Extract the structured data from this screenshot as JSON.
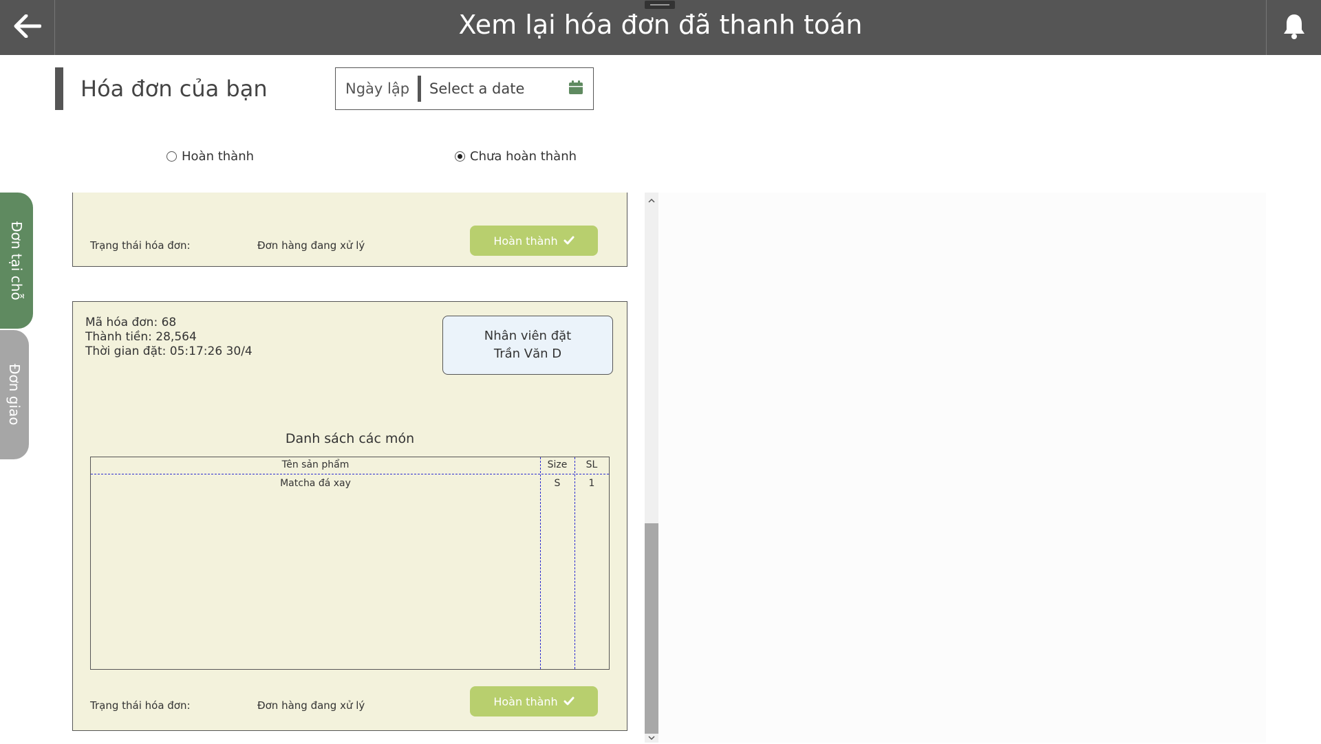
{
  "topbar": {
    "title": "Xem lại hóa đơn đã thanh toán",
    "back_icon": "arrow-left-icon",
    "bell_icon": "bell-icon"
  },
  "header": {
    "title": "Hóa đơn của bạn",
    "date_filter": {
      "label": "Ngày lập",
      "placeholder": "Select a date",
      "icon": "calendar-icon"
    }
  },
  "filters": {
    "options": [
      {
        "label": "Hoàn thành",
        "checked": false
      },
      {
        "label": "Chưa hoàn thành",
        "checked": true
      }
    ]
  },
  "side_tabs": [
    {
      "label": "Đơn tại chỗ",
      "active": true
    },
    {
      "label": "Đơn giao",
      "active": false
    }
  ],
  "table_headers": {
    "product": "Tên sản phẩm",
    "size": "Size",
    "qty": "SL"
  },
  "orders": [
    {
      "status_label": "Trạng thái hóa đơn:",
      "status_value": "Đơn hàng đang xử lý",
      "complete_button": "Hoàn thành"
    },
    {
      "id_line": "Mã hóa đơn: 68",
      "total_line": "Thành tiền: 28,564",
      "time_line": "Thời gian đặt: 05:17:26 30/4",
      "staff_title": "Nhân viên đặt",
      "staff_name": "Trần Văn D",
      "items_title": "Danh sách các món",
      "items": [
        {
          "name": "Matcha đá xay",
          "size": "S",
          "qty": "1"
        }
      ],
      "status_label": "Trạng thái hóa đơn:",
      "status_value": "Đơn hàng đang xử lý",
      "complete_button": "Hoàn thành"
    }
  ],
  "colors": {
    "topbar": "#555555",
    "card_bg": "#f3f2dc",
    "complete_button": "#b8cf6e",
    "tab_active": "#5f8a60",
    "tab_inactive": "#a6a6a6",
    "staff_box": "#ebf3fa",
    "calendar_icon": "#5f8a60"
  }
}
